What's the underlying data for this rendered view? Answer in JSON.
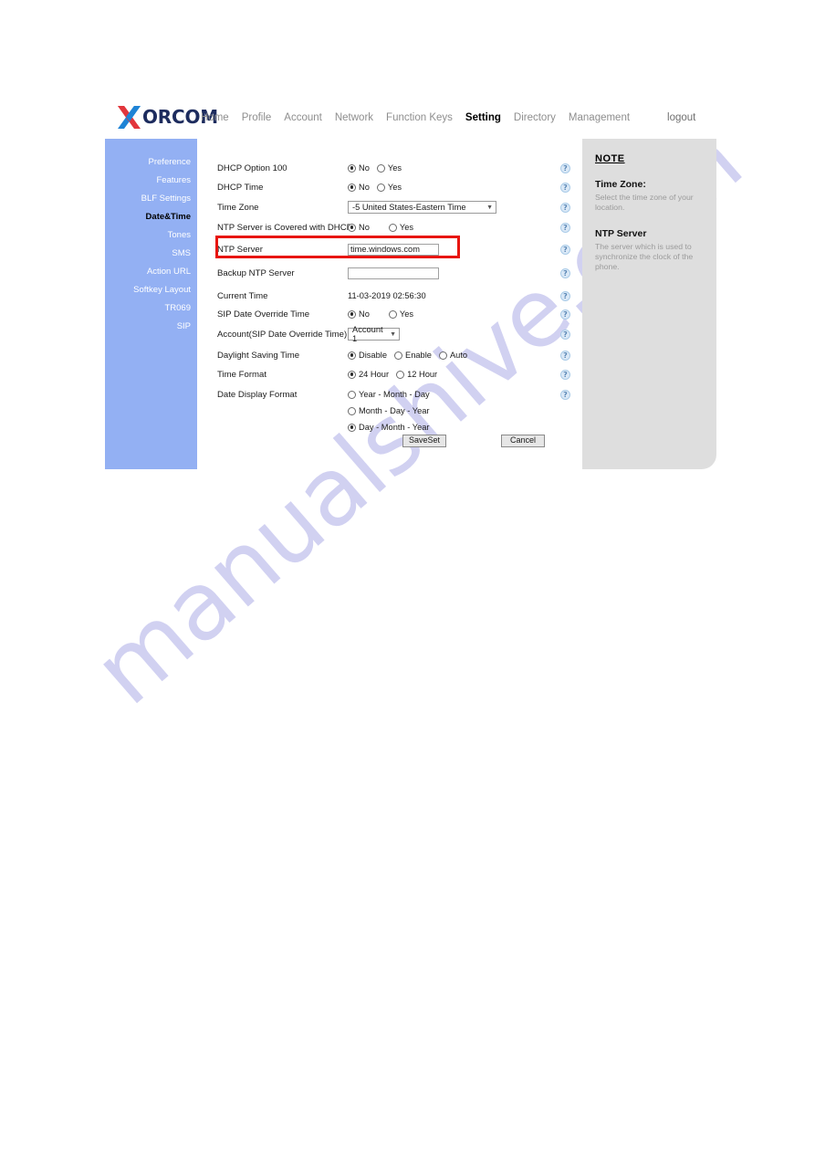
{
  "header": {
    "logo_x": "X",
    "logo_word": "ORCOM",
    "nav_items": [
      {
        "label": "Home",
        "active": false
      },
      {
        "label": "Profile",
        "active": false
      },
      {
        "label": "Account",
        "active": false
      },
      {
        "label": "Network",
        "active": false
      },
      {
        "label": "Function Keys",
        "active": false
      },
      {
        "label": "Setting",
        "active": true
      },
      {
        "label": "Directory",
        "active": false
      },
      {
        "label": "Management",
        "active": false
      }
    ],
    "logout": "logout"
  },
  "sidebar": {
    "items": [
      {
        "label": "Preference",
        "active": false
      },
      {
        "label": "Features",
        "active": false
      },
      {
        "label": "BLF Settings",
        "active": false
      },
      {
        "label": "Date&Time",
        "active": true
      },
      {
        "label": "Tones",
        "active": false
      },
      {
        "label": "SMS",
        "active": false
      },
      {
        "label": "Action URL",
        "active": false
      },
      {
        "label": "Softkey Layout",
        "active": false
      },
      {
        "label": "TR069",
        "active": false
      },
      {
        "label": "SIP",
        "active": false
      }
    ]
  },
  "form": {
    "dhcp_option_100": {
      "label": "DHCP Option 100",
      "options": [
        "No",
        "Yes"
      ],
      "selected": "No"
    },
    "dhcp_time": {
      "label": "DHCP Time",
      "options": [
        "No",
        "Yes"
      ],
      "selected": "No"
    },
    "time_zone": {
      "label": "Time Zone",
      "value": "-5 United States-Eastern Time"
    },
    "ntp_covered_dhcp": {
      "label": "NTP Server is Covered with DHCP",
      "options": [
        "No",
        "Yes"
      ],
      "selected": "No"
    },
    "ntp_server": {
      "label": "NTP Server",
      "value": "time.windows.com",
      "placeholder": ""
    },
    "backup_ntp_server": {
      "label": "Backup NTP Server",
      "value": "",
      "placeholder": ""
    },
    "current_time": {
      "label": "Current Time",
      "value": "11-03-2019 02:56:30"
    },
    "sip_date_override": {
      "label": "SIP Date Override Time",
      "options": [
        "No",
        "Yes"
      ],
      "selected": "No"
    },
    "account_sip_override": {
      "label": "Account(SIP Date Override Time)",
      "value": "Account 1"
    },
    "daylight_saving": {
      "label": "Daylight Saving Time",
      "options": [
        "Disable",
        "Enable",
        "Auto"
      ],
      "selected": "Disable"
    },
    "time_format": {
      "label": "Time Format",
      "options": [
        "24 Hour",
        "12 Hour"
      ],
      "selected": "24 Hour"
    },
    "date_display_format": {
      "label": "Date Display Format",
      "options": [
        "Year - Month - Day",
        "Month - Day - Year",
        "Day - Month - Year"
      ],
      "selected": "Day - Month - Year"
    },
    "help_icon_glyph": "?",
    "save_label": "SaveSet",
    "cancel_label": "Cancel"
  },
  "note": {
    "title": "NOTE",
    "sections": [
      {
        "heading": "Time Zone:",
        "body": "Select the time zone of your location."
      },
      {
        "heading": "NTP Server",
        "body": "The server which is used to synchronize the clock of the phone."
      }
    ]
  },
  "watermark": {
    "text": "manualshive.com"
  },
  "colors": {
    "sidebar_bg": "#93b0f3",
    "note_bg": "#dedede",
    "highlight": "#e8150f",
    "logo_navy": "#1d2c5e",
    "logo_red": "#e2363c",
    "logo_blue": "#1f84d6"
  }
}
